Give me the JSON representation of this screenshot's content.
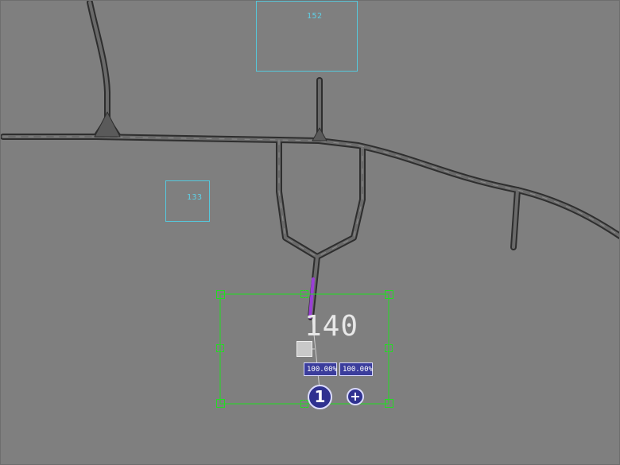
{
  "zones": [
    {
      "id": "152",
      "label": "152"
    },
    {
      "id": "133",
      "label": "133"
    }
  ],
  "selection": {
    "value_label": "140",
    "scale_x": "100.00%",
    "scale_y": "100.00%",
    "order_number": "1",
    "add_symbol": "+"
  },
  "colors": {
    "background": "#7f7f7f",
    "road_outline": "#2e2e2e",
    "road_fill": "#6a6a6a",
    "zone_outline": "#56c8dc",
    "selection_box": "#22dd22",
    "badge_fill": "#3b3d9c",
    "highlight_segment": "#9a3fd6"
  },
  "icons": {
    "move_handle": "square-handle-icon",
    "add": "plus-icon"
  }
}
